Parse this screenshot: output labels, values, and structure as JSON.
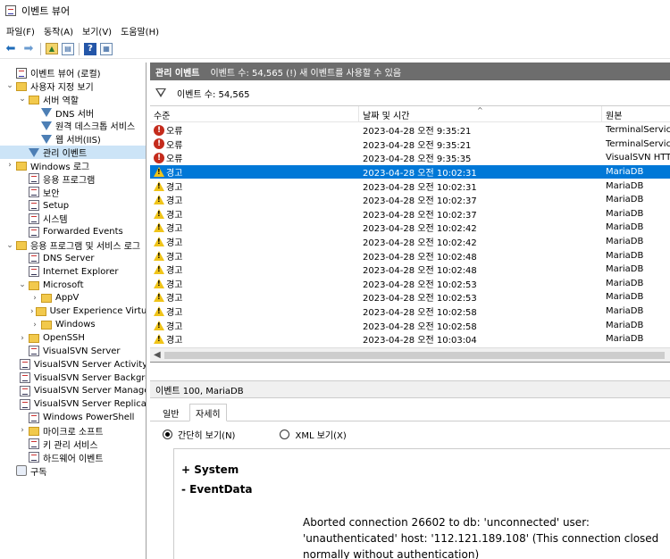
{
  "window": {
    "title": "이벤트 뷰어"
  },
  "menu": [
    "파일(F)",
    "동작(A)",
    "보기(V)",
    "도움말(H)"
  ],
  "toolbar": {
    "icons": [
      "back-arrow-icon",
      "forward-arrow-icon",
      "up-folder-icon",
      "show-hide-tree-icon",
      "help-icon",
      "properties-icon"
    ]
  },
  "tree": [
    {
      "label": "이벤트 뷰어 (로컬)",
      "indent": 0,
      "twisty": "",
      "icon": "viewer"
    },
    {
      "label": "사용자 지정 보기",
      "indent": 0,
      "twisty": "v",
      "icon": "folder"
    },
    {
      "label": "서버 역할",
      "indent": 1,
      "twisty": "v",
      "icon": "folder"
    },
    {
      "label": "DNS 서버",
      "indent": 2,
      "twisty": "",
      "icon": "filter"
    },
    {
      "label": "원격 데스크톱 서비스",
      "indent": 2,
      "twisty": "",
      "icon": "filter"
    },
    {
      "label": "웹 서버(IIS)",
      "indent": 2,
      "twisty": "",
      "icon": "filter"
    },
    {
      "label": "관리 이벤트",
      "indent": 1,
      "twisty": "",
      "icon": "filter",
      "selected": true
    },
    {
      "label": "Windows 로그",
      "indent": 0,
      "twisty": ">",
      "icon": "folder"
    },
    {
      "label": "응용 프로그램",
      "indent": 1,
      "twisty": "",
      "icon": "log"
    },
    {
      "label": "보안",
      "indent": 1,
      "twisty": "",
      "icon": "log"
    },
    {
      "label": "Setup",
      "indent": 1,
      "twisty": "",
      "icon": "log"
    },
    {
      "label": "시스템",
      "indent": 1,
      "twisty": "",
      "icon": "log"
    },
    {
      "label": "Forwarded Events",
      "indent": 1,
      "twisty": "",
      "icon": "log"
    },
    {
      "label": "응용 프로그램 및 서비스 로그",
      "indent": 0,
      "twisty": "v",
      "icon": "folder"
    },
    {
      "label": "DNS Server",
      "indent": 1,
      "twisty": "",
      "icon": "log"
    },
    {
      "label": "Internet Explorer",
      "indent": 1,
      "twisty": "",
      "icon": "log"
    },
    {
      "label": "Microsoft",
      "indent": 1,
      "twisty": "v",
      "icon": "folder"
    },
    {
      "label": "AppV",
      "indent": 2,
      "twisty": ">",
      "icon": "folder"
    },
    {
      "label": "User Experience Virtualization",
      "indent": 2,
      "twisty": ">",
      "icon": "folder"
    },
    {
      "label": "Windows",
      "indent": 2,
      "twisty": ">",
      "icon": "folder"
    },
    {
      "label": "OpenSSH",
      "indent": 1,
      "twisty": ">",
      "icon": "folder"
    },
    {
      "label": "VisualSVN Server",
      "indent": 1,
      "twisty": "",
      "icon": "log"
    },
    {
      "label": "VisualSVN Server Activity",
      "indent": 1,
      "twisty": "",
      "icon": "log"
    },
    {
      "label": "VisualSVN Server Background",
      "indent": 1,
      "twisty": "",
      "icon": "log"
    },
    {
      "label": "VisualSVN Server Management",
      "indent": 1,
      "twisty": "",
      "icon": "log"
    },
    {
      "label": "VisualSVN Server Replication",
      "indent": 1,
      "twisty": "",
      "icon": "log"
    },
    {
      "label": "Windows PowerShell",
      "indent": 1,
      "twisty": "",
      "icon": "log"
    },
    {
      "label": "마이크로 소프트",
      "indent": 1,
      "twisty": ">",
      "icon": "folder"
    },
    {
      "label": "키 관리 서비스",
      "indent": 1,
      "twisty": "",
      "icon": "log"
    },
    {
      "label": "하드웨어 이벤트",
      "indent": 1,
      "twisty": "",
      "icon": "log"
    },
    {
      "label": "구독",
      "indent": 0,
      "twisty": "",
      "icon": "sub"
    }
  ],
  "right_header": {
    "title": "관리 이벤트",
    "info": "이벤트 수: 54,565 (!) 새 이벤트를 사용할 수 있음"
  },
  "filter_bar": {
    "text": "이벤트 수: 54,565"
  },
  "columns": {
    "level": "수준",
    "datetime": "날짜 및 시간",
    "source": "원본"
  },
  "events": [
    {
      "type": "error",
      "level": "오류",
      "datetime": "2023-04-28 오전 9:35:21",
      "source": "TerminalServices"
    },
    {
      "type": "error",
      "level": "오류",
      "datetime": "2023-04-28 오전 9:35:21",
      "source": "TerminalServices"
    },
    {
      "type": "error",
      "level": "오류",
      "datetime": "2023-04-28 오전 9:35:35",
      "source": "VisualSVN HTTP"
    },
    {
      "type": "warning",
      "level": "경고",
      "datetime": "2023-04-28 오전 10:02:31",
      "source": "MariaDB",
      "selected": true
    },
    {
      "type": "warning",
      "level": "경고",
      "datetime": "2023-04-28 오전 10:02:31",
      "source": "MariaDB"
    },
    {
      "type": "warning",
      "level": "경고",
      "datetime": "2023-04-28 오전 10:02:37",
      "source": "MariaDB"
    },
    {
      "type": "warning",
      "level": "경고",
      "datetime": "2023-04-28 오전 10:02:37",
      "source": "MariaDB"
    },
    {
      "type": "warning",
      "level": "경고",
      "datetime": "2023-04-28 오전 10:02:42",
      "source": "MariaDB"
    },
    {
      "type": "warning",
      "level": "경고",
      "datetime": "2023-04-28 오전 10:02:42",
      "source": "MariaDB"
    },
    {
      "type": "warning",
      "level": "경고",
      "datetime": "2023-04-28 오전 10:02:48",
      "source": "MariaDB"
    },
    {
      "type": "warning",
      "level": "경고",
      "datetime": "2023-04-28 오전 10:02:48",
      "source": "MariaDB"
    },
    {
      "type": "warning",
      "level": "경고",
      "datetime": "2023-04-28 오전 10:02:53",
      "source": "MariaDB"
    },
    {
      "type": "warning",
      "level": "경고",
      "datetime": "2023-04-28 오전 10:02:53",
      "source": "MariaDB"
    },
    {
      "type": "warning",
      "level": "경고",
      "datetime": "2023-04-28 오전 10:02:58",
      "source": "MariaDB"
    },
    {
      "type": "warning",
      "level": "경고",
      "datetime": "2023-04-28 오전 10:02:58",
      "source": "MariaDB"
    },
    {
      "type": "warning",
      "level": "경고",
      "datetime": "2023-04-28 오전 10:03:04",
      "source": "MariaDB"
    },
    {
      "type": "warning",
      "level": "경고",
      "datetime": "2023-04-28 오전 10:03:04",
      "source": "MariaDB"
    }
  ],
  "detail": {
    "header": "이벤트 100, MariaDB",
    "tabs": [
      "일반",
      "자세히"
    ],
    "active_tab": 1,
    "view_options": [
      "간단히 보기(N)",
      "XML 보기(X)"
    ],
    "selected_view": 0,
    "system_node": "+ System",
    "eventdata_node": "- EventData",
    "message": "Aborted connection 26602 to db: 'unconnected' user: 'unauthenticated' host: '112.121.189.108' (This connection closed normally without authentication)"
  },
  "colors": {
    "selection": "#0078d7",
    "tree_selection": "#cce4f7",
    "header_bg": "#6d6d6d",
    "error": "#c42b1c",
    "warning": "#f0c419"
  }
}
